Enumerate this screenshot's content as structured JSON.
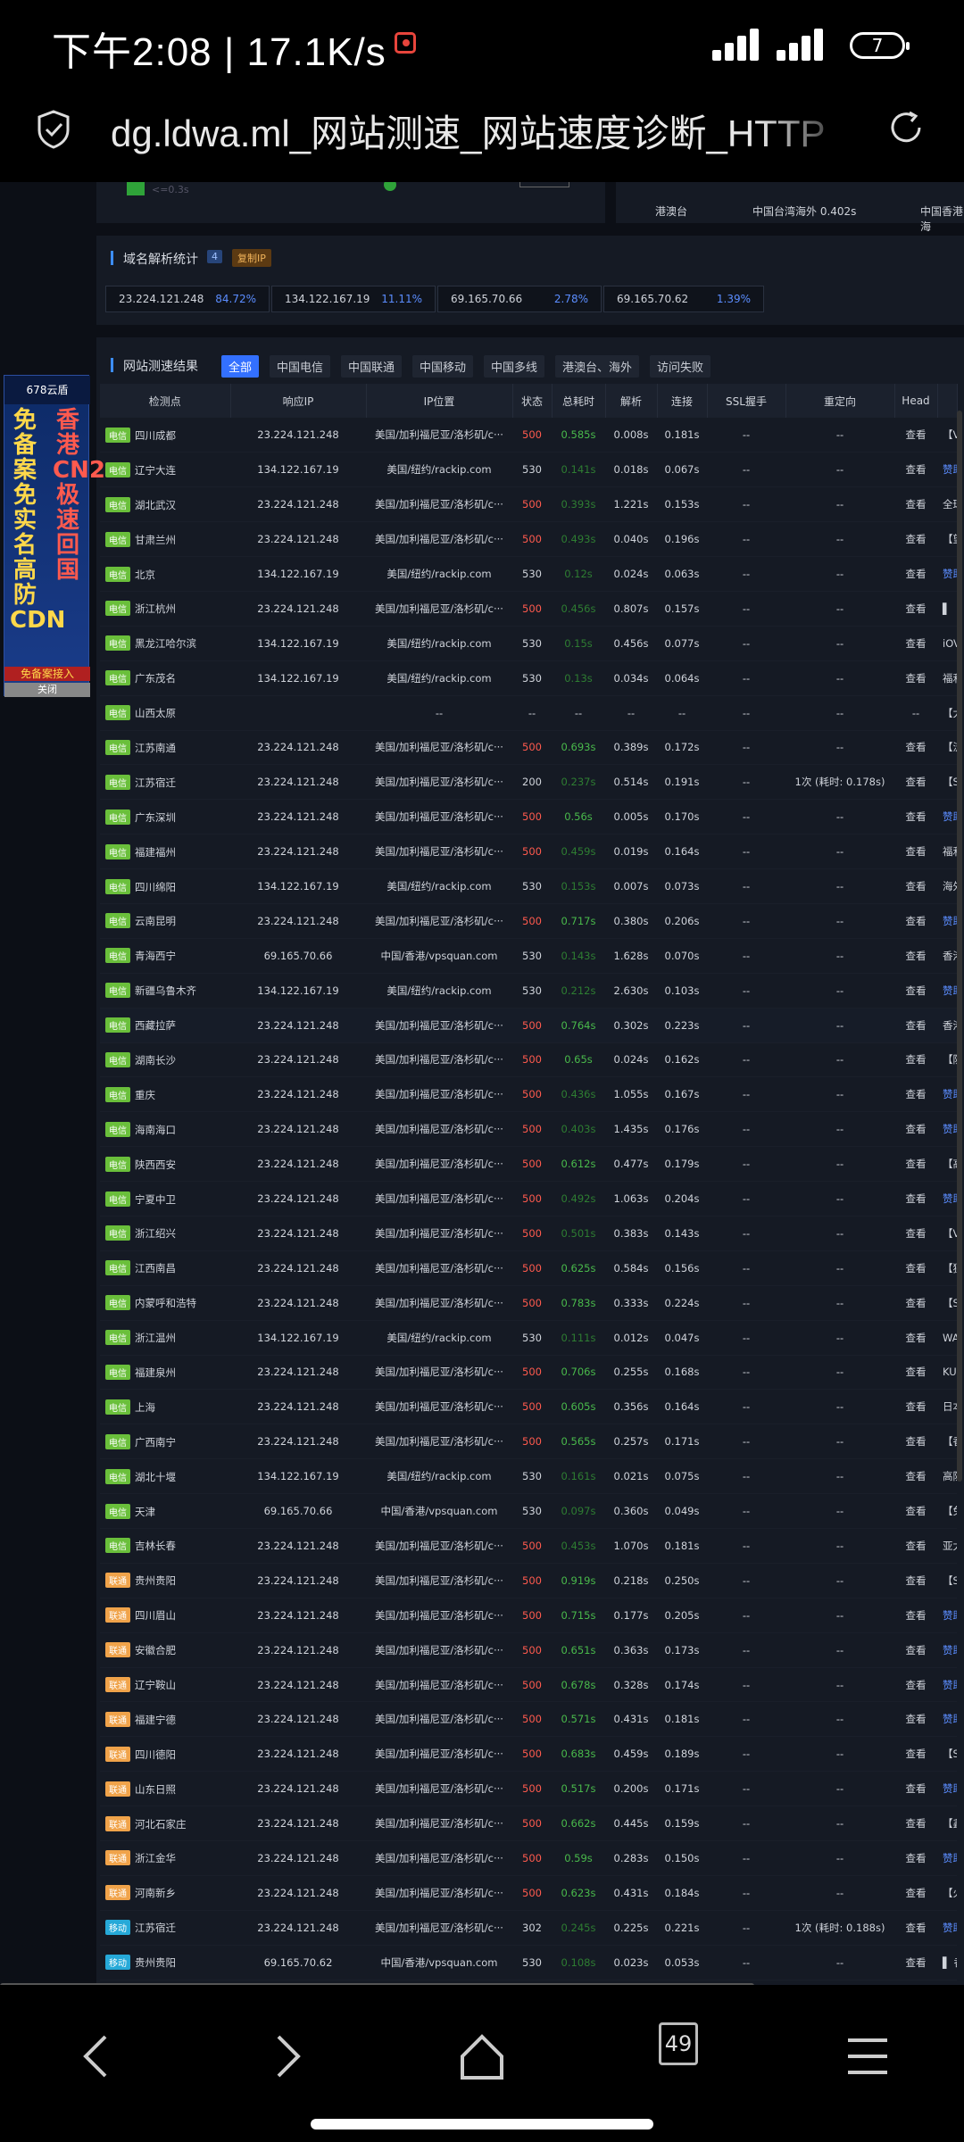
{
  "status_bar": {
    "time_speed": "下午2:08 | 17.1K/s",
    "battery": "7"
  },
  "browser": {
    "title": "dg.ldwa.ml_网站测速_网站速度诊断_HTTP",
    "tab_count": "49"
  },
  "top_partial": {
    "legend": "<=0.3s",
    "hk_label": "港澳台",
    "hk_value": "中国台湾海外 0.402s",
    "hk_value2": "中国香港海"
  },
  "dns": {
    "title": "域名解析统计",
    "count": "4",
    "copy_label": "复制IP",
    "entries": [
      {
        "ip": "23.224.121.248",
        "pct": "84.72%"
      },
      {
        "ip": "134.122.167.19",
        "pct": "11.11%"
      },
      {
        "ip": "69.165.70.66",
        "pct": "2.78%"
      },
      {
        "ip": "69.165.70.62",
        "pct": "1.39%"
      }
    ]
  },
  "results": {
    "title": "网站测速结果",
    "tabs": [
      "全部",
      "中国电信",
      "中国联通",
      "中国移动",
      "中国多线",
      "港澳台、海外",
      "访问失败"
    ],
    "columns": [
      "检测点",
      "响应IP",
      "IP位置",
      "状态",
      "总耗时",
      "解析",
      "连接",
      "SSL握手",
      "重定向",
      "Head"
    ],
    "view_label": "查看",
    "rows": [
      [
        "电信",
        "四川成都",
        "23.224.121.248",
        "美国/加利福尼亚/洛杉矶/c···",
        "500",
        "0.585s",
        "0.008s",
        "0.181s",
        "--",
        "--",
        "【V"
      ],
      [
        "电信",
        "辽宁大连",
        "134.122.167.19",
        "美国/纽约/rackip.com",
        "530",
        "0.141s",
        "0.018s",
        "0.067s",
        "--",
        "--",
        "赞助"
      ],
      [
        "电信",
        "湖北武汉",
        "23.224.121.248",
        "美国/加利福尼亚/洛杉矶/c···",
        "500",
        "0.393s",
        "1.221s",
        "0.153s",
        "--",
        "--",
        "全球"
      ],
      [
        "电信",
        "甘肃兰州",
        "23.224.121.248",
        "美国/加利福尼亚/洛杉矶/c···",
        "500",
        "0.493s",
        "0.040s",
        "0.196s",
        "--",
        "--",
        "【望"
      ],
      [
        "电信",
        "北京",
        "134.122.167.19",
        "美国/纽约/rackip.com",
        "530",
        "0.12s",
        "0.024s",
        "0.063s",
        "--",
        "--",
        "赞助"
      ],
      [
        "电信",
        "浙江杭州",
        "23.224.121.248",
        "美国/加利福尼亚/洛杉矶/c···",
        "500",
        "0.456s",
        "0.807s",
        "0.157s",
        "--",
        "--",
        "▌"
      ],
      [
        "电信",
        "黑龙江哈尔滨",
        "134.122.167.19",
        "美国/纽约/rackip.com",
        "530",
        "0.15s",
        "0.456s",
        "0.077s",
        "--",
        "--",
        "iOV"
      ],
      [
        "电信",
        "广东茂名",
        "134.122.167.19",
        "美国/纽约/rackip.com",
        "530",
        "0.13s",
        "0.034s",
        "0.064s",
        "--",
        "--",
        "福利"
      ],
      [
        "电信",
        "山西太原",
        "",
        "--",
        "--",
        "--",
        "--",
        "--",
        "--",
        "--",
        "【大"
      ],
      [
        "电信",
        "江苏南通",
        "23.224.121.248",
        "美国/加利福尼亚/洛杉矶/c···",
        "500",
        "0.693s",
        "0.389s",
        "0.172s",
        "--",
        "--",
        "【流"
      ],
      [
        "电信",
        "江苏宿迁",
        "23.224.121.248",
        "美国/加利福尼亚/洛杉矶/c···",
        "200",
        "0.237s",
        "0.514s",
        "0.191s",
        "--",
        "1次 (耗时: 0.178s)",
        "【SI"
      ],
      [
        "电信",
        "广东深圳",
        "23.224.121.248",
        "美国/加利福尼亚/洛杉矶/c···",
        "500",
        "0.56s",
        "0.005s",
        "0.170s",
        "--",
        "--",
        "赞助"
      ],
      [
        "电信",
        "福建福州",
        "23.224.121.248",
        "美国/加利福尼亚/洛杉矶/c···",
        "500",
        "0.459s",
        "0.019s",
        "0.164s",
        "--",
        "--",
        "福利"
      ],
      [
        "电信",
        "四川绵阳",
        "134.122.167.19",
        "美国/纽约/rackip.com",
        "530",
        "0.153s",
        "0.007s",
        "0.073s",
        "--",
        "--",
        "海外"
      ],
      [
        "电信",
        "云南昆明",
        "23.224.121.248",
        "美国/加利福尼亚/洛杉矶/c···",
        "500",
        "0.717s",
        "0.380s",
        "0.206s",
        "--",
        "--",
        "赞助"
      ],
      [
        "电信",
        "青海西宁",
        "69.165.70.66",
        "中国/香港/vpsquan.com",
        "530",
        "0.143s",
        "1.628s",
        "0.070s",
        "--",
        "--",
        "香港"
      ],
      [
        "电信",
        "新疆乌鲁木齐",
        "134.122.167.19",
        "美国/纽约/rackip.com",
        "530",
        "0.212s",
        "2.630s",
        "0.103s",
        "--",
        "--",
        "赞助"
      ],
      [
        "电信",
        "西藏拉萨",
        "23.224.121.248",
        "美国/加利福尼亚/洛杉矶/c···",
        "500",
        "0.764s",
        "0.302s",
        "0.223s",
        "--",
        "--",
        "香港"
      ],
      [
        "电信",
        "湖南长沙",
        "23.224.121.248",
        "美国/加利福尼亚/洛杉矶/c···",
        "500",
        "0.65s",
        "0.024s",
        "0.162s",
        "--",
        "--",
        "【防"
      ],
      [
        "电信",
        "重庆",
        "23.224.121.248",
        "美国/加利福尼亚/洛杉矶/c···",
        "500",
        "0.436s",
        "1.055s",
        "0.167s",
        "--",
        "--",
        "赞助"
      ],
      [
        "电信",
        "海南海口",
        "23.224.121.248",
        "美国/加利福尼亚/洛杉矶/c···",
        "500",
        "0.403s",
        "1.435s",
        "0.176s",
        "--",
        "--",
        "赞助"
      ],
      [
        "电信",
        "陕西西安",
        "23.224.121.248",
        "美国/加利福尼亚/洛杉矶/c···",
        "500",
        "0.612s",
        "0.477s",
        "0.179s",
        "--",
        "--",
        "【高"
      ],
      [
        "电信",
        "宁夏中卫",
        "23.224.121.248",
        "美国/加利福尼亚/洛杉矶/c···",
        "500",
        "0.492s",
        "1.063s",
        "0.204s",
        "--",
        "--",
        "赞助"
      ],
      [
        "电信",
        "浙江绍兴",
        "23.224.121.248",
        "美国/加利福尼亚/洛杉矶/c···",
        "500",
        "0.501s",
        "0.383s",
        "0.143s",
        "--",
        "--",
        "【V"
      ],
      [
        "电信",
        "江西南昌",
        "23.224.121.248",
        "美国/加利福尼亚/洛杉矶/c···",
        "500",
        "0.625s",
        "0.584s",
        "0.156s",
        "--",
        "--",
        "【独"
      ],
      [
        "电信",
        "内蒙呼和浩特",
        "23.224.121.248",
        "美国/加利福尼亚/洛杉矶/c···",
        "500",
        "0.783s",
        "0.333s",
        "0.224s",
        "--",
        "--",
        "【SI"
      ],
      [
        "电信",
        "浙江温州",
        "134.122.167.19",
        "美国/纽约/rackip.com",
        "530",
        "0.111s",
        "0.012s",
        "0.047s",
        "--",
        "--",
        "WAF"
      ],
      [
        "电信",
        "福建泉州",
        "23.224.121.248",
        "美国/加利福尼亚/洛杉矶/c···",
        "500",
        "0.706s",
        "0.255s",
        "0.168s",
        "--",
        "--",
        "KUR"
      ],
      [
        "电信",
        "上海",
        "23.224.121.248",
        "美国/加利福尼亚/洛杉矶/c···",
        "500",
        "0.605s",
        "0.356s",
        "0.164s",
        "--",
        "--",
        "日本"
      ],
      [
        "电信",
        "广西南宁",
        "23.224.121.248",
        "美国/加利福尼亚/洛杉矶/c···",
        "500",
        "0.565s",
        "0.257s",
        "0.171s",
        "--",
        "--",
        "【香"
      ],
      [
        "电信",
        "湖北十堰",
        "134.122.167.19",
        "美国/纽约/rackip.com",
        "530",
        "0.161s",
        "0.021s",
        "0.075s",
        "--",
        "--",
        "高防"
      ],
      [
        "电信",
        "天津",
        "69.165.70.66",
        "中国/香港/vpsquan.com",
        "530",
        "0.097s",
        "0.360s",
        "0.049s",
        "--",
        "--",
        "【免"
      ],
      [
        "电信",
        "吉林长春",
        "23.224.121.248",
        "美国/加利福尼亚/洛杉矶/c···",
        "500",
        "0.453s",
        "1.070s",
        "0.181s",
        "--",
        "--",
        "亚太"
      ],
      [
        "联通",
        "贵州贵阳",
        "23.224.121.248",
        "美国/加利福尼亚/洛杉矶/c···",
        "500",
        "0.919s",
        "0.218s",
        "0.250s",
        "--",
        "--",
        "【SI"
      ],
      [
        "联通",
        "四川眉山",
        "23.224.121.248",
        "美国/加利福尼亚/洛杉矶/c···",
        "500",
        "0.715s",
        "0.177s",
        "0.205s",
        "--",
        "--",
        "赞助"
      ],
      [
        "联通",
        "安徽合肥",
        "23.224.121.248",
        "美国/加利福尼亚/洛杉矶/c···",
        "500",
        "0.651s",
        "0.363s",
        "0.173s",
        "--",
        "--",
        "赞助"
      ],
      [
        "联通",
        "辽宁鞍山",
        "23.224.121.248",
        "美国/加利福尼亚/洛杉矶/c···",
        "500",
        "0.678s",
        "0.328s",
        "0.174s",
        "--",
        "--",
        "赞助"
      ],
      [
        "联通",
        "福建宁德",
        "23.224.121.248",
        "美国/加利福尼亚/洛杉矶/c···",
        "500",
        "0.571s",
        "0.431s",
        "0.181s",
        "--",
        "--",
        "赞助"
      ],
      [
        "联通",
        "四川德阳",
        "23.224.121.248",
        "美国/加利福尼亚/洛杉矶/c···",
        "500",
        "0.683s",
        "0.459s",
        "0.189s",
        "--",
        "--",
        "【SI"
      ],
      [
        "联通",
        "山东日照",
        "23.224.121.248",
        "美国/加利福尼亚/洛杉矶/c···",
        "500",
        "0.517s",
        "0.200s",
        "0.171s",
        "--",
        "--",
        "赞助"
      ],
      [
        "联通",
        "河北石家庄",
        "23.224.121.248",
        "美国/加利福尼亚/洛杉矶/c···",
        "500",
        "0.662s",
        "0.445s",
        "0.159s",
        "--",
        "--",
        "【鑫"
      ],
      [
        "联通",
        "浙江金华",
        "23.224.121.248",
        "美国/加利福尼亚/洛杉矶/c···",
        "500",
        "0.59s",
        "0.283s",
        "0.150s",
        "--",
        "--",
        "赞助"
      ],
      [
        "联通",
        "河南新乡",
        "23.224.121.248",
        "美国/加利福尼亚/洛杉矶/c···",
        "500",
        "0.623s",
        "0.431s",
        "0.184s",
        "--",
        "--",
        "【火"
      ],
      [
        "移动",
        "江苏宿迁",
        "23.224.121.248",
        "美国/加利福尼亚/洛杉矶/c···",
        "302",
        "0.245s",
        "0.225s",
        "0.221s",
        "--",
        "1次 (耗时: 0.188s)",
        "赞助"
      ],
      [
        "移动",
        "贵州贵阳",
        "69.165.70.62",
        "中国/香港/vpsquan.com",
        "530",
        "0.108s",
        "0.023s",
        "0.053s",
        "--",
        "--",
        "▌ 香"
      ]
    ]
  },
  "ad": {
    "brand": "678云盾",
    "col_left": "免备案免实名高防CDN",
    "col_right": "香港CN2极速回国",
    "footer": "免备案接入",
    "sub": "免实名",
    "close": "关闭"
  }
}
